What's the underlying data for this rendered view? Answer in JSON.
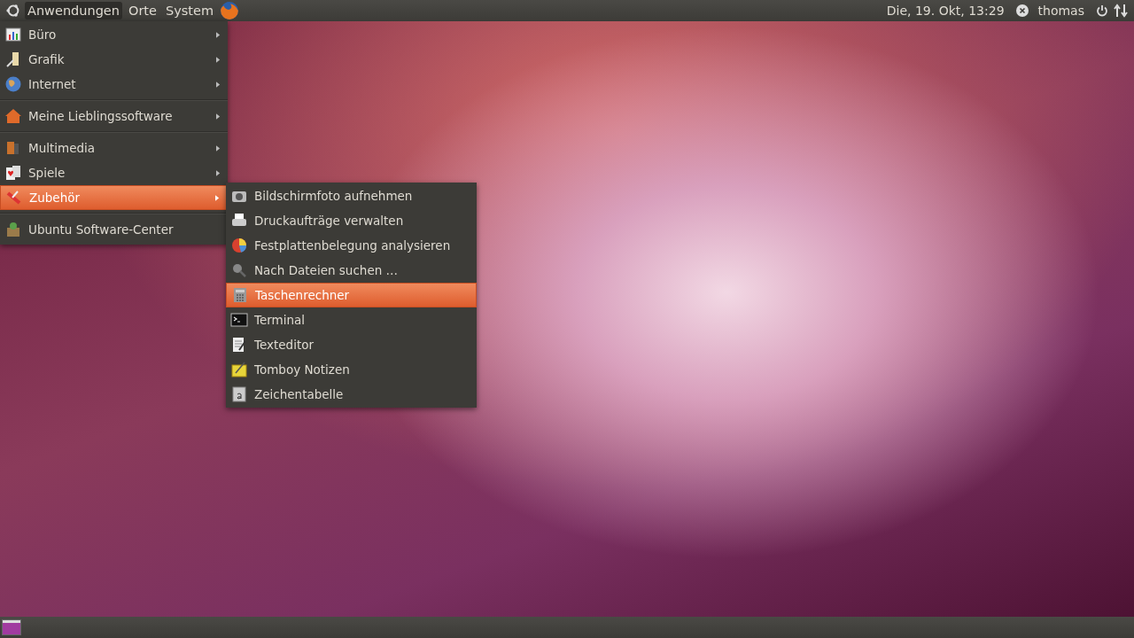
{
  "top_panel": {
    "menus": [
      {
        "label": "Anwendungen",
        "selected": true
      },
      {
        "label": "Orte",
        "selected": false
      },
      {
        "label": "System",
        "selected": false
      }
    ],
    "clock": "Die, 19. Okt, 13:29",
    "user": "thomas"
  },
  "applications_menu": {
    "groups": [
      [
        {
          "label": "Büro",
          "has_submenu": true,
          "selected": false
        },
        {
          "label": "Grafik",
          "has_submenu": true,
          "selected": false
        },
        {
          "label": "Internet",
          "has_submenu": true,
          "selected": false
        }
      ],
      [
        {
          "label": "Meine Lieblingssoftware",
          "has_submenu": true,
          "selected": false
        }
      ],
      [
        {
          "label": "Multimedia",
          "has_submenu": true,
          "selected": false
        },
        {
          "label": "Spiele",
          "has_submenu": true,
          "selected": false
        },
        {
          "label": "Zubehör",
          "has_submenu": true,
          "selected": true
        }
      ],
      [
        {
          "label": "Ubuntu Software-Center",
          "has_submenu": false,
          "selected": false
        }
      ]
    ]
  },
  "submenu": {
    "items": [
      {
        "label": "Bildschirmfoto aufnehmen",
        "selected": false
      },
      {
        "label": "Druckaufträge verwalten",
        "selected": false
      },
      {
        "label": "Festplattenbelegung analysieren",
        "selected": false
      },
      {
        "label": "Nach Dateien suchen …",
        "selected": false
      },
      {
        "label": "Taschenrechner",
        "selected": true
      },
      {
        "label": "Terminal",
        "selected": false
      },
      {
        "label": "Texteditor",
        "selected": false
      },
      {
        "label": "Tomboy Notizen",
        "selected": false
      },
      {
        "label": "Zeichentabelle",
        "selected": false
      }
    ]
  }
}
